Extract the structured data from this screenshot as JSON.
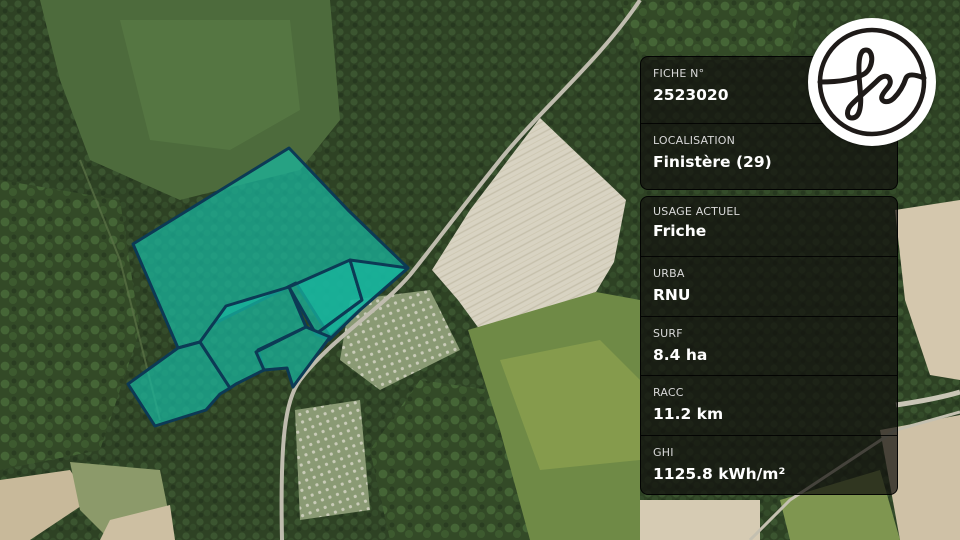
{
  "map": {
    "parcel_color": "#17b7a0",
    "parcel_outline_color": "#0c3a55"
  },
  "brand": {
    "logo_icon": "fs-monogram-icon"
  },
  "info": {
    "fiche": {
      "label": "FICHE N°",
      "value": "2523020"
    },
    "localisation": {
      "label": "LOCALISATION",
      "value": "Finistère (29)"
    },
    "usage": {
      "label": "USAGE ACTUEL",
      "value": "Friche"
    },
    "urba": {
      "label": "URBA",
      "value": "RNU"
    },
    "surf": {
      "label": "SURF",
      "value": "8.4 ha"
    },
    "racc": {
      "label": "RACC",
      "value": "11.2 km"
    },
    "ghi": {
      "label": "GHI",
      "value": "1125.8 kWh/m²"
    }
  }
}
